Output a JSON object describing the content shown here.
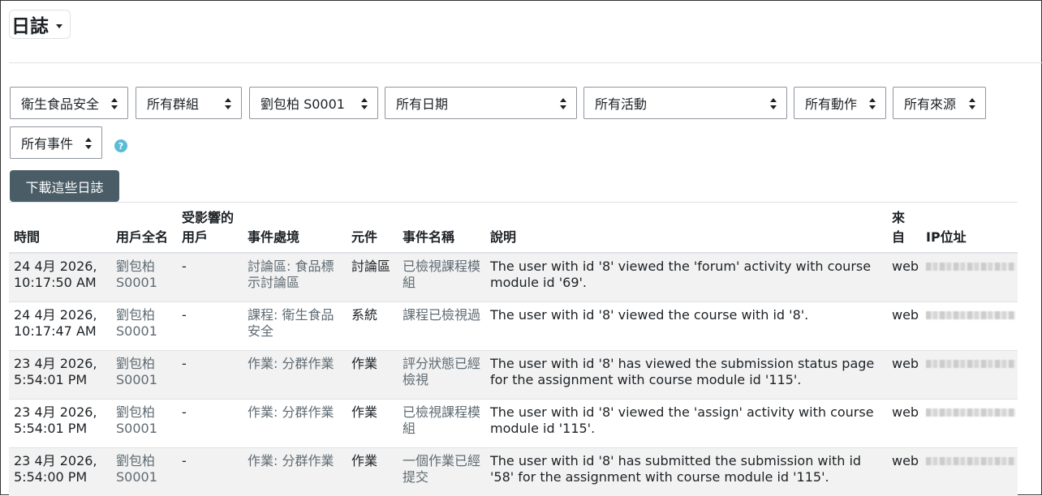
{
  "page": {
    "title": "日誌"
  },
  "filters": [
    {
      "id": "course",
      "label": "衛生食品安全"
    },
    {
      "id": "group",
      "label": "所有群組"
    },
    {
      "id": "user",
      "label": "劉包柏 S0001"
    },
    {
      "id": "date",
      "label": "所有日期"
    },
    {
      "id": "activity",
      "label": "所有活動"
    },
    {
      "id": "action",
      "label": "所有動作"
    },
    {
      "id": "origin",
      "label": "所有來源"
    },
    {
      "id": "event",
      "label": "所有事件"
    }
  ],
  "help_icon": {
    "name": "help-icon",
    "glyph": "?",
    "color": "#5bbcd8"
  },
  "download_button": {
    "label": "下載這些日誌",
    "color": "#4a5c66"
  },
  "table": {
    "headers": {
      "time": "時間",
      "user_full_name": "用戶全名",
      "affected_user_1": "受影響的",
      "affected_user_2": "用戶",
      "event_context": "事件處境",
      "component": "元件",
      "event_name": "事件名稱",
      "description": "說明",
      "origin_1": "來",
      "origin_2": "自",
      "ip": "IP位址"
    },
    "rows": [
      {
        "time_1": "24 4月 2026,",
        "time_2": "10:17:50 AM",
        "user_1": "劉包柏",
        "user_2": "S0001",
        "affected": "-",
        "context": "討論區: 食品標示討論區",
        "component": "討論區",
        "event": "已檢視課程模組",
        "description": "The user with id '8' viewed the 'forum' activity with course module id '69'.",
        "origin": "web",
        "ip": ""
      },
      {
        "time_1": "24 4月 2026,",
        "time_2": "10:17:47 AM",
        "user_1": "劉包柏",
        "user_2": "S0001",
        "affected": "-",
        "context": "課程: 衛生食品安全",
        "component": "系統",
        "event": "課程已檢視過",
        "description": "The user with id '8' viewed the course with id '8'.",
        "origin": "web",
        "ip": ""
      },
      {
        "time_1": "23 4月 2026,",
        "time_2": "5:54:01 PM",
        "user_1": "劉包柏",
        "user_2": "S0001",
        "affected": "-",
        "context": "作業: 分群作業",
        "component": "作業",
        "event": "評分狀態已經檢視",
        "description": "The user with id '8' has viewed the submission status page for the assignment with course module id '115'.",
        "origin": "web",
        "ip": ""
      },
      {
        "time_1": "23 4月 2026,",
        "time_2": "5:54:01 PM",
        "user_1": "劉包柏",
        "user_2": "S0001",
        "affected": "-",
        "context": "作業: 分群作業",
        "component": "作業",
        "event": "已檢視課程模組",
        "description": "The user with id '8' viewed the 'assign' activity with course module id '115'.",
        "origin": "web",
        "ip": ""
      },
      {
        "time_1": "23 4月 2026,",
        "time_2": "5:54:00 PM",
        "user_1": "劉包柏",
        "user_2": "S0001",
        "affected": "-",
        "context": "作業: 分群作業",
        "component": "作業",
        "event": "一個作業已經提交",
        "description": "The user with id '8' has submitted the submission with id '58' for the assignment with course module id '115'.",
        "origin": "web",
        "ip": ""
      }
    ]
  }
}
